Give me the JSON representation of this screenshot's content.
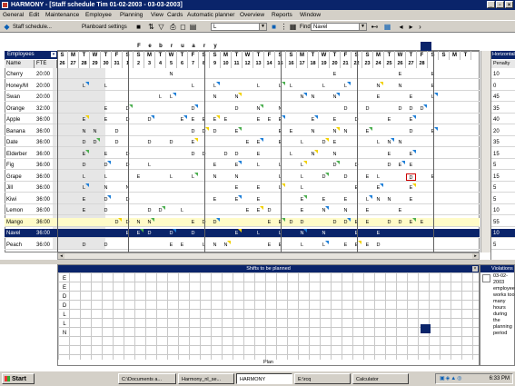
{
  "window": {
    "title": "HARMONY - [Staff schedule Tim 01-02-2003 - 03-03-2003]"
  },
  "menu": [
    "General",
    "Edit",
    "Maintenance",
    "Employee",
    "Planning",
    "View",
    "Cards",
    "Automatic planner",
    "Overview",
    "Reports",
    "Window"
  ],
  "toolbar": {
    "schedule_button": "Staff schedule...",
    "planboard_button": "Planboard settings",
    "combo_value": "L",
    "find_label": "Find",
    "find_value": "Navel"
  },
  "month_letters": [
    "F",
    "e",
    "b",
    "r",
    "u",
    "a",
    "r",
    "y"
  ],
  "grid": {
    "employees_header": "Employees",
    "name_header": "Name",
    "fte_header": "FTE",
    "day_letters": [
      "S",
      "M",
      "T",
      "W",
      "T",
      "F",
      "S",
      "S",
      "M",
      "T",
      "W",
      "T",
      "F",
      "S",
      "S",
      "M",
      "T",
      "W",
      "T",
      "F",
      "S",
      "S",
      "M",
      "T",
      "W",
      "T",
      "F",
      "S",
      "S",
      "M",
      "T",
      "W",
      "T",
      "F",
      "S",
      "S",
      "M",
      "T",
      "W"
    ],
    "day_numbers": [
      "26",
      "27",
      "28",
      "29",
      "30",
      "31",
      "1",
      "2",
      "3",
      "4",
      "5",
      "6",
      "7",
      "8",
      "9",
      "10",
      "11",
      "12",
      "13",
      "14",
      "15",
      "16",
      "17",
      "18",
      "19",
      "20",
      "21",
      "22",
      "23",
      "24",
      "25",
      "26",
      "27",
      "28"
    ],
    "employees": [
      {
        "name": "Cherry",
        "fte": "20:00"
      },
      {
        "name": "Honey/M",
        "fte": "20:00"
      },
      {
        "name": "Swan",
        "fte": "20:00"
      },
      {
        "name": "Orange",
        "fte": "32:00"
      },
      {
        "name": "Apple",
        "fte": "36:00"
      },
      {
        "name": "Banana",
        "fte": "36:00"
      },
      {
        "name": "Date",
        "fte": "36:00"
      },
      {
        "name": "Elderber",
        "fte": "36:00"
      },
      {
        "name": "Fig",
        "fte": "36:00"
      },
      {
        "name": "Grape",
        "fte": "36:00"
      },
      {
        "name": "Jill",
        "fte": "36:00"
      },
      {
        "name": "Kiwi",
        "fte": "36:00"
      },
      {
        "name": "Lemon",
        "fte": "36:00"
      },
      {
        "name": "Mango",
        "fte": "36:00"
      },
      {
        "name": "Navel",
        "fte": "36:00"
      },
      {
        "name": "Peach",
        "fte": "36:00"
      }
    ],
    "shift_rows": [
      "..........N..............E.....E..E",
      "..L.L.......L.L...L.LL..L.L..N.N..E",
      ".........LL...N.N.....NN.N...E..E.L",
      "....E.D.....D...D.N.N.....D.D..DDD",
      "..E.E.D.D..EEEEE..EEE..E.E.D..E.E",
      "..NN.D......DDD.E...EE.N.NN.E...D.E",
      "..DD.D..D.D.E....EE.E.L.DE...LNN..",
      "..E.E.D.....DD.DD.E..L.N.N....E.E.",
      "..D.D.D.L.....E.E.L.L.L..D.D..DEE",
      "..L.L..E..L.L.N.N...L.L.D.D.EL..D.E",
      "..L.N.N.........E.E.L.L....E.E..E",
      "..E.D.D.......E.E.E...E.E.E.LNN.E",
      "..E.D...DD.L.....EED..E.N.N.E..E",
      ".....DDNN...EDD....EEDD..DDEE.DDEE",
      "......EED.D.D...E.L.L.N.N..E.E.",
      "..D.D.....EE.LNN...EE.L.L.EEED.."
    ]
  },
  "right_panel": {
    "title": "Horizontal",
    "sub": "Penalty",
    "values": [
      "10",
      "0",
      "45",
      "35",
      "40",
      "20",
      "35",
      "15",
      "5",
      "15",
      "5",
      "5",
      "10",
      "55",
      "10",
      "5"
    ]
  },
  "shift_panel": {
    "title": "Shifts to be planned",
    "list": [
      "E",
      "E",
      "D",
      "D",
      "L",
      "L",
      "N"
    ],
    "footer": "Plan"
  },
  "violations_panel": {
    "title": "Violations",
    "text": "03-02-2003\nemployee works too many hours during the planning period"
  },
  "taskbar": {
    "start": "Start",
    "tasks": [
      "C:\\Documents a...",
      "Harmony_nl_se...",
      "HARMONY",
      "E:\\rcq",
      "Calculator"
    ],
    "clock": "6:33 PM"
  }
}
